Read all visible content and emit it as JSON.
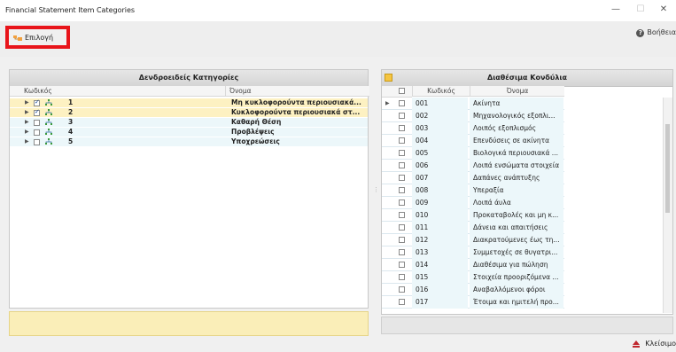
{
  "window": {
    "title": "Financial Statement Item Categories",
    "minimize": "—",
    "maximize": "☐",
    "close": "✕"
  },
  "toolbar": {
    "select_label": "Επιλογή",
    "help_label": "Βοήθεια"
  },
  "left_panel": {
    "header": "Δενδροειδείς Κατηγορίες",
    "col_code": "Κωδικός",
    "col_name": "Όνομα",
    "rows": [
      {
        "code": "1",
        "name": "Μη κυκλοφορούντα περιουσιακά...",
        "checked": true
      },
      {
        "code": "2",
        "name": "Κυκλοφορούντα περιουσιακά στ...",
        "checked": true
      },
      {
        "code": "3",
        "name": "Καθαρή Θέση",
        "checked": false
      },
      {
        "code": "4",
        "name": "Προβλέψεις",
        "checked": false
      },
      {
        "code": "5",
        "name": "Υποχρεώσεις",
        "checked": false
      }
    ]
  },
  "right_panel": {
    "header": "Διαθέσιμα Κονδύλια",
    "col_code": "Κωδικός",
    "col_name": "Όνομα",
    "rows": [
      {
        "code": "001",
        "name": "Ακίνητα"
      },
      {
        "code": "002",
        "name": "Μηχανολογικός εξοπλι..."
      },
      {
        "code": "003",
        "name": "Λοιπός εξοπλισμός"
      },
      {
        "code": "004",
        "name": "Επενδύσεις σε ακίνητα"
      },
      {
        "code": "005",
        "name": "Βιολογικά περιουσιακά ..."
      },
      {
        "code": "006",
        "name": "Λοιπά ενσώματα στοιχεία"
      },
      {
        "code": "007",
        "name": "Δαπάνες ανάπτυξης"
      },
      {
        "code": "008",
        "name": "Υπεραξία"
      },
      {
        "code": "009",
        "name": "Λοιπά άυλα"
      },
      {
        "code": "010",
        "name": "Προκαταβολές και μη κ..."
      },
      {
        "code": "011",
        "name": "Δάνεια και απαιτήσεις"
      },
      {
        "code": "012",
        "name": "Διακρατούμενες έως τη..."
      },
      {
        "code": "013",
        "name": "Συμμετοχές σε θυγατρι..."
      },
      {
        "code": "014",
        "name": "Διαθέσιμα για πώληση"
      },
      {
        "code": "015",
        "name": "Στοιχεία προοριζόμενα ..."
      },
      {
        "code": "016",
        "name": "Αναβαλλόμενοι φόροι"
      },
      {
        "code": "017",
        "name": "Έτοιμα και ημιτελή προ..."
      }
    ]
  },
  "footer": {
    "close_label": "Κλείσιμο"
  },
  "colors": {
    "highlight_row": "#fdf1c2",
    "alt_row": "#ecf7fa",
    "selected_outline": "#e8141a"
  }
}
